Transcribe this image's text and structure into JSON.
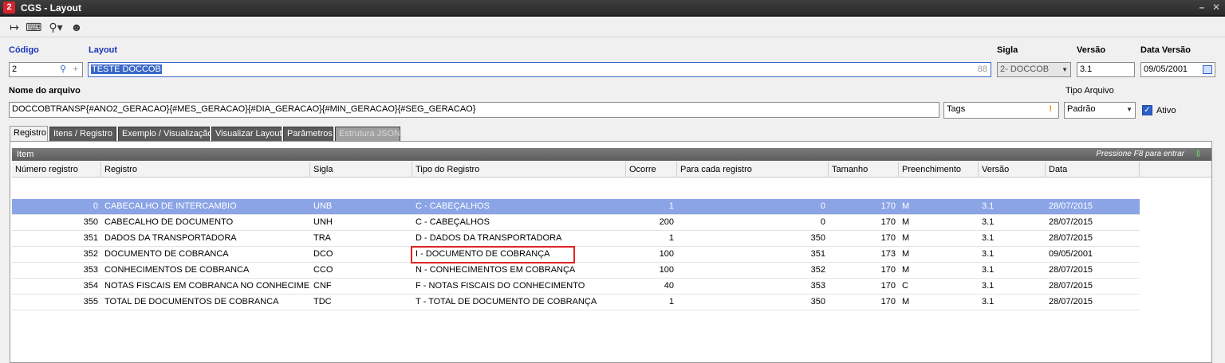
{
  "window": {
    "title": "CGS - Layout",
    "app_icon": "2"
  },
  "toolbar": {
    "icons": [
      "exit-icon",
      "keyboard-icon",
      "search-icon",
      "user-icon"
    ]
  },
  "form": {
    "codigo_label": "Código",
    "codigo_value": "2",
    "layout_label": "Layout",
    "layout_value": "TESTE DOCCOB",
    "layout_count": "88",
    "sigla_label": "Sigla",
    "sigla_value": "2- DOCCOB",
    "versao_label": "Versão",
    "versao_value": "3.1",
    "data_versao_label": "Data Versão",
    "data_versao_value": "09/05/2001",
    "nome_arquivo_label": "Nome do arquivo",
    "nome_arquivo_value": "DOCCOBTRANSP{#ANO2_GERACAO}{#MES_GERACAO}{#DIA_GERACAO}{#MIN_GERACAO}{#SEG_GERACAO}",
    "tags_value": "Tags",
    "tipo_arquivo_label": "Tipo Arquivo",
    "tipo_arquivo_value": "Padrão",
    "ativo_label": "Ativo"
  },
  "tabs": [
    {
      "label": "Registro"
    },
    {
      "label": "Itens / Registro"
    },
    {
      "label": "Exemplo / Visualização"
    },
    {
      "label": "Visualizar Layout"
    },
    {
      "label": "Parâmetros"
    },
    {
      "label": "Estrutura JSON"
    }
  ],
  "grid": {
    "title": "Item",
    "hint": "Pressione F8 para entrar",
    "columns": [
      "Número registro",
      "Registro",
      "Sigla",
      "Tipo do Registro",
      "Ocorre",
      "Para cada registro",
      "Tamanho",
      "Preenchimento",
      "Versão",
      "Data"
    ],
    "rows": [
      {
        "numero": "0",
        "registro": "CABECALHO DE INTERCAMBIO",
        "sigla": "UNB",
        "tipo": "C - CABEÇALHOS",
        "ocorre": "1",
        "para_cada": "0",
        "tamanho": "170",
        "preenchimento": "M",
        "versao": "3.1",
        "data": "28/07/2015"
      },
      {
        "numero": "350",
        "registro": "CABECALHO DE DOCUMENTO",
        "sigla": "UNH",
        "tipo": "C - CABEÇALHOS",
        "ocorre": "200",
        "para_cada": "0",
        "tamanho": "170",
        "preenchimento": "M",
        "versao": "3.1",
        "data": "28/07/2015"
      },
      {
        "numero": "351",
        "registro": "DADOS DA TRANSPORTADORA",
        "sigla": "TRA",
        "tipo": "D - DADOS DA TRANSPORTADORA",
        "ocorre": "1",
        "para_cada": "350",
        "tamanho": "170",
        "preenchimento": "M",
        "versao": "3.1",
        "data": "28/07/2015"
      },
      {
        "numero": "352",
        "registro": "DOCUMENTO DE COBRANCA",
        "sigla": "DCO",
        "tipo": "I - DOCUMENTO DE COBRANÇA",
        "ocorre": "100",
        "para_cada": "351",
        "tamanho": "173",
        "preenchimento": "M",
        "versao": "3.1",
        "data": "09/05/2001"
      },
      {
        "numero": "353",
        "registro": "CONHECIMENTOS DE COBRANCA",
        "sigla": "CCO",
        "tipo": "N - CONHECIMENTOS EM COBRANÇA",
        "ocorre": "100",
        "para_cada": "352",
        "tamanho": "170",
        "preenchimento": "M",
        "versao": "3.1",
        "data": "28/07/2015"
      },
      {
        "numero": "354",
        "registro": "NOTAS FISCAIS EM COBRANCA NO CONHECIMENTO",
        "sigla": "CNF",
        "tipo": "F - NOTAS FISCAIS DO CONHECIMENTO",
        "ocorre": "40",
        "para_cada": "353",
        "tamanho": "170",
        "preenchimento": "C",
        "versao": "3.1",
        "data": "28/07/2015"
      },
      {
        "numero": "355",
        "registro": "TOTAL DE DOCUMENTOS DE COBRANCA",
        "sigla": "TDC",
        "tipo": "T - TOTAL DE DOCUMENTO DE COBRANÇA",
        "ocorre": "1",
        "para_cada": "350",
        "tamanho": "170",
        "preenchimento": "M",
        "versao": "3.1",
        "data": "28/07/2015"
      }
    ]
  },
  "colors": {
    "accent": "#3a67c8",
    "selected_row": "#8aa4e6",
    "highlight": "#e02424",
    "label_blue": "#1a34b8"
  }
}
